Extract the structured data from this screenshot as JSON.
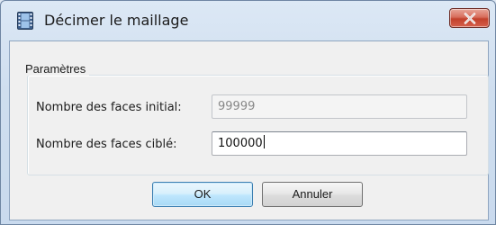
{
  "window": {
    "title": "Décimer le maillage",
    "close_symbol": "×"
  },
  "group": {
    "title": "Paramètres",
    "initial_label": "Nombre des faces initial:",
    "initial_value": "99999",
    "target_label": "Nombre des faces ciblé:",
    "target_value": "100000"
  },
  "buttons": {
    "ok_label": "OK",
    "cancel_label": "Annuler"
  },
  "icons": {
    "app": "film-strip-icon",
    "close": "close-icon"
  },
  "colors": {
    "close_button": "#c2412c",
    "default_button_border": "#3c7fb1"
  }
}
